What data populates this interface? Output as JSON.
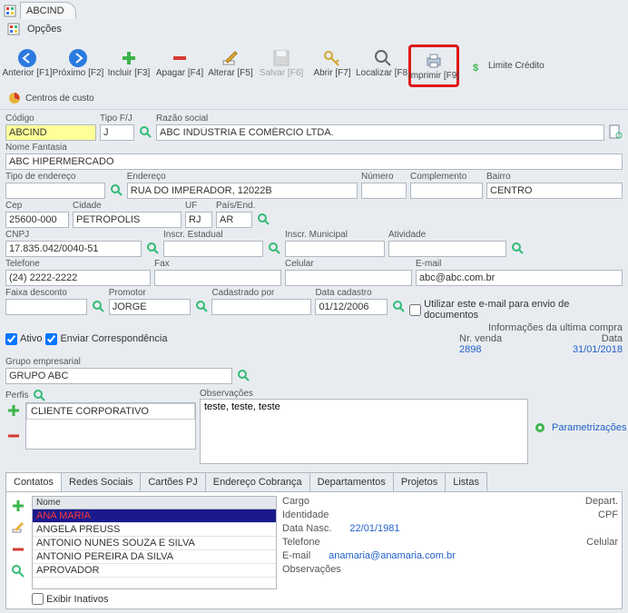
{
  "tab_title": "ABCIND",
  "options_label": "Opções",
  "toolbar": {
    "anterior": "Anterior [F1]",
    "proximo": "Próximo [F2]",
    "incluir": "Incluir [F3]",
    "apagar": "Apagar [F4]",
    "alterar": "Alterar [F5]",
    "salvar": "Salvar [F6]",
    "abrir": "Abrir [F7]",
    "localizar": "Localizar [F8]",
    "imprimir": "Imprimir [F9]",
    "limite": "Limite Crédito",
    "centros": "Centros de custo"
  },
  "labels": {
    "codigo": "Código",
    "tipofj": "Tipo F/J",
    "razao": "Razão social",
    "fantasia": "Nome Fantasia",
    "tipoend": "Tipo de endereço",
    "endereco": "Endereço",
    "numero": "Número",
    "complemento": "Complemento",
    "bairro": "Bairro",
    "cep": "Cep",
    "cidade": "Cidade",
    "uf": "UF",
    "paisend": "País/End.",
    "cnpj": "CNPJ",
    "inscest": "Inscr. Estadual",
    "inscmun": "Inscr. Municipal",
    "atividade": "Atividade",
    "telefone": "Telefone",
    "fax": "Fax",
    "celular": "Celular",
    "email": "E-mail",
    "faixa": "Faixa desconto",
    "promotor": "Promotor",
    "cadpor": "Cadastrado por",
    "datacad": "Data cadastro",
    "utilizaremail": "Utilizar este e-mail para envio de documentos",
    "ativo": "Ativo",
    "enviarcorr": "Enviar Correspondência",
    "grupo": "Grupo empresarial",
    "perfis": "Perfis",
    "observ": "Observações",
    "param": "Parametrizações",
    "infoultima": "Informações da ultima compra",
    "nrvenda": "Nr. venda",
    "data": "Data",
    "nome": "Nome",
    "cargo": "Cargo",
    "depart": "Depart.",
    "identidade": "Identidade",
    "cpf": "CPF",
    "datanasc": "Data Nasc.",
    "exibirinativos": "Exibir Inativos"
  },
  "values": {
    "codigo": "ABCIND",
    "tipofj": "J",
    "razao": "ABC INDÚSTRIA E COMÉRCIO LTDA.",
    "fantasia": "ABC HIPERMERCADO",
    "tipoend": "",
    "endereco": "RUA DO IMPERADOR, 12022B",
    "bairro": "CENTRO",
    "cep": "25600-000",
    "cidade": "PETRÓPOLIS",
    "uf": "RJ",
    "paisend": "AR",
    "cnpj": "17.835.042/0040-51",
    "telefone": "(24) 2222-2222",
    "email": "abc@abc.com.br",
    "promotor": "JORGE",
    "datacad": "01/12/2006",
    "grupo": "GRUPO ABC",
    "perfil0": "CLIENTE CORPORATIVO",
    "observ": "teste, teste, teste",
    "nrvenda": "2898",
    "dataultima": "31/01/2018",
    "c_datanasc": "22/01/1981",
    "c_email": "anamaria@anamaria.com.br"
  },
  "tabs": {
    "contatos": "Contatos",
    "redes": "Redes Sociais",
    "cartoes": "Cartões PJ",
    "endcob": "Endereço Cobrança",
    "depart": "Departamentos",
    "projetos": "Projetos",
    "listas": "Listas"
  },
  "contacts": [
    "ANA MARIA",
    "ANGELA PREUSS",
    "ANTONIO NUNES SOUZA E SILVA",
    "ANTONIO PEREIRA DA SILVA",
    "APROVADOR"
  ]
}
